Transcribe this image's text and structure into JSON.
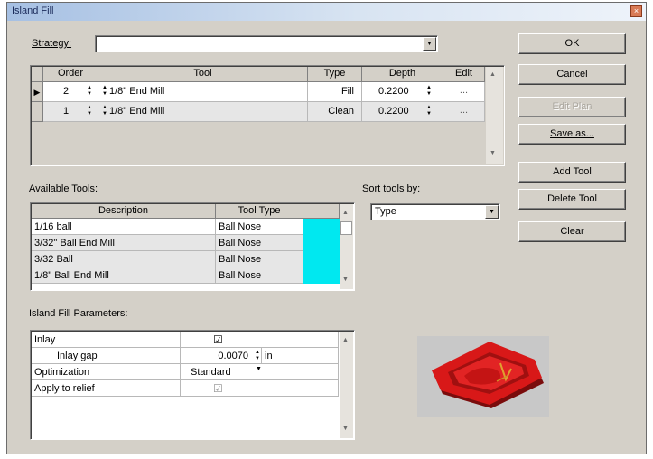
{
  "window": {
    "title": "Island Fill",
    "close_glyph": "×"
  },
  "strategy": {
    "label": "Strategy:",
    "value": ""
  },
  "order_table": {
    "headers": [
      "Order",
      "Tool",
      "Type",
      "Depth",
      "Edit"
    ],
    "rows": [
      {
        "indicator": "▶",
        "order": "2",
        "tool": "1/8\" End Mill",
        "type": "Fill",
        "depth": "0.2200",
        "edit": "..."
      },
      {
        "indicator": "",
        "order": "1",
        "tool": "1/8\" End Mill",
        "type": "Clean",
        "depth": "0.2200",
        "edit": "..."
      }
    ]
  },
  "buttons": {
    "ok": "OK",
    "cancel": "Cancel",
    "edit_plan": "Edit Plan",
    "save_as": "Save as...",
    "add_tool": "Add Tool",
    "delete_tool": "Delete Tool",
    "clear": "Clear"
  },
  "available_tools": {
    "label": "Available Tools:",
    "headers": [
      "Description",
      "Tool Type"
    ],
    "rows": [
      {
        "description": "1/16 ball",
        "tool_type": "Ball Nose"
      },
      {
        "description": "3/32\" Ball End Mill",
        "tool_type": "Ball Nose"
      },
      {
        "description": "3/32  Ball",
        "tool_type": "Ball Nose"
      },
      {
        "description": "1/8\" Ball End Mill",
        "tool_type": "Ball Nose"
      }
    ],
    "swatch_color": "#00e8f0"
  },
  "sort": {
    "label": "Sort tools by:",
    "value": "Type"
  },
  "params": {
    "label": "Island Fill Parameters:",
    "rows": [
      {
        "name": "Inlay",
        "value": "☑"
      },
      {
        "name": "Inlay gap",
        "value": "0.0070",
        "unit": "in"
      },
      {
        "name": "Optimization",
        "value": "Standard"
      },
      {
        "name": "Apply to relief",
        "value": "☑"
      }
    ]
  },
  "colors": {
    "preview_bg": "#c8c8c8",
    "model_red": "#d81818"
  }
}
